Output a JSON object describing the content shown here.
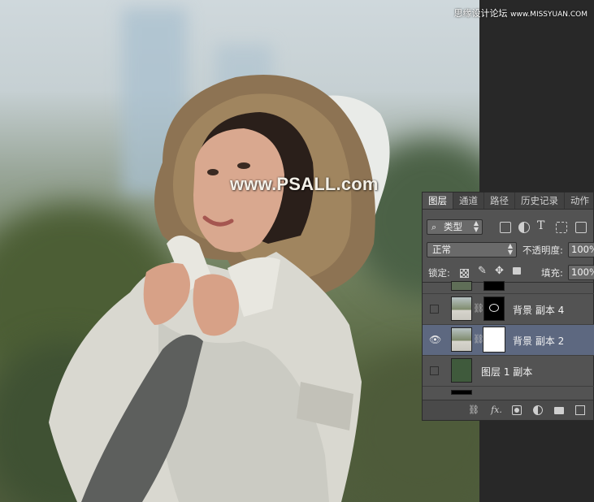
{
  "watermark": {
    "main": "www.PSALL.com"
  },
  "corner_watermark": {
    "cn": "思缘设计论坛",
    "url": "www.MISSYUAN.COM"
  },
  "layers_panel": {
    "tabs": [
      {
        "label": "图层",
        "active": true
      },
      {
        "label": "通道",
        "active": false
      },
      {
        "label": "路径",
        "active": false
      },
      {
        "label": "历史记录",
        "active": false
      },
      {
        "label": "动作",
        "active": false
      }
    ],
    "filter": {
      "label": "类型",
      "icon": "search-icon"
    },
    "filter_icons": [
      "image-filter-icon",
      "adjustment-filter-icon",
      "text-filter-icon",
      "shape-filter-icon",
      "smart-object-filter-icon"
    ],
    "blend_mode": "正常",
    "opacity": {
      "label": "不透明度:",
      "value": "100%"
    },
    "lock": {
      "label": "锁定:"
    },
    "fill": {
      "label": "填充:",
      "value": "100%"
    },
    "layers": [
      {
        "name": "背景 副本 4",
        "visible": false,
        "selected": false,
        "mask": "black"
      },
      {
        "name": "背景 副本 2",
        "visible": true,
        "selected": true,
        "mask": "white"
      },
      {
        "name": "图层 1 副本",
        "visible": false,
        "selected": false,
        "color": "#3f5a3c"
      }
    ],
    "bottom_icons": [
      "link-icon",
      "fx-icon",
      "mask-icon",
      "adjustment-icon",
      "folder-icon",
      "new-layer-icon"
    ],
    "fx_label": "fx."
  }
}
